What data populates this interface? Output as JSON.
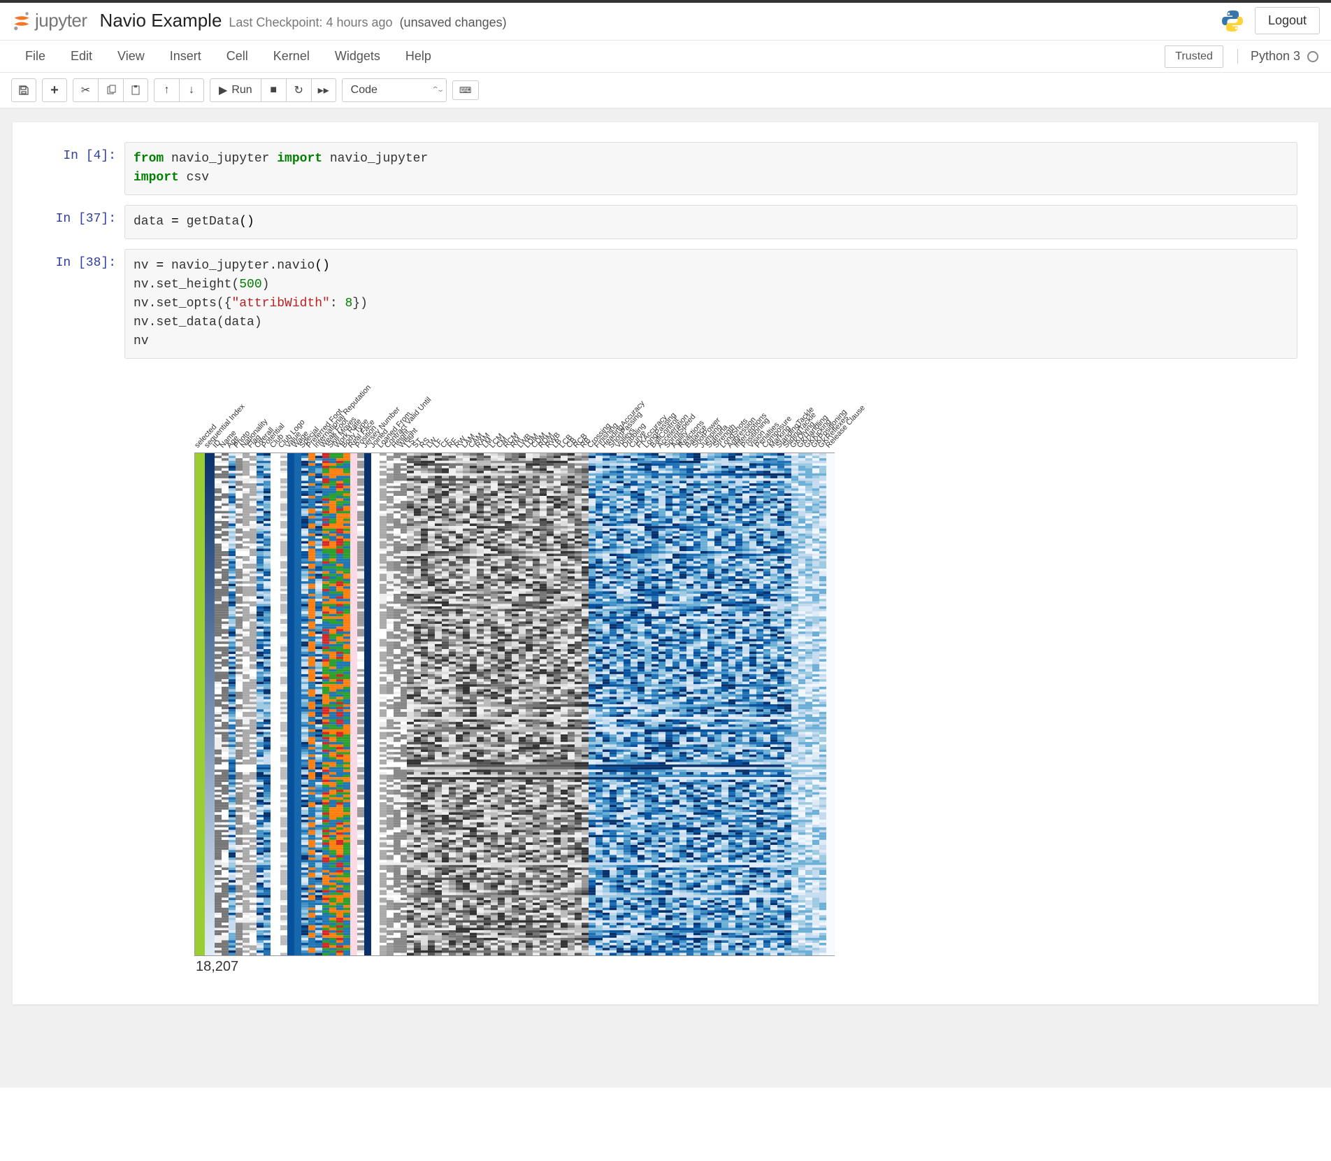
{
  "header": {
    "logo_text": "jupyter",
    "notebook_name": "Navio Example",
    "checkpoint": "Last Checkpoint: 4 hours ago",
    "unsaved": "(unsaved changes)",
    "logout": "Logout"
  },
  "menu": {
    "items": [
      "File",
      "Edit",
      "View",
      "Insert",
      "Cell",
      "Kernel",
      "Widgets",
      "Help"
    ],
    "trusted": "Trusted",
    "kernel": "Python 3"
  },
  "toolbar": {
    "run_label": "Run",
    "celltype": "Code"
  },
  "cells": [
    {
      "prompt": "In [4]:",
      "code_html": "<span class=\"kw\">from</span> navio_jupyter <span class=\"kw\">import</span> navio_jupyter\n<span class=\"kw\">import</span> csv"
    },
    {
      "prompt": "In [37]:",
      "code_html": "data <span class=\"pn\">=</span> getData<span class=\"pn\">()</span>"
    },
    {
      "prompt": "In [38]:",
      "code_html": "nv <span class=\"pn\">=</span> navio_jupyter.navio<span class=\"pn\">()</span>\nnv.set_height(<span class=\"num2\">500</span>)\nnv.set_opts({<span class=\"str\">\"attribWidth\"</span>: <span class=\"num2\">8</span>})\nnv.set_data(data)\nnv"
    }
  ],
  "navio": {
    "row_count": "18,207",
    "columns": [
      {
        "name": "selected",
        "w": 14,
        "style": "solid",
        "color": "#9ACD32"
      },
      {
        "name": "sequential Index",
        "w": 14,
        "style": "grad",
        "from": "#08306b",
        "to": "#deebf7"
      },
      {
        "name": "ID",
        "w": 10,
        "style": "bars",
        "color": "#777"
      },
      {
        "name": "Name",
        "w": 10,
        "style": "bars",
        "color": "#777"
      },
      {
        "name": "Age",
        "w": 10,
        "style": "blue"
      },
      {
        "name": "Photo",
        "w": 10,
        "style": "bars",
        "color": "#888"
      },
      {
        "name": "Nationality",
        "w": 10,
        "style": "bars",
        "color": "#aaa"
      },
      {
        "name": "Flag",
        "w": 10,
        "style": "bars",
        "color": "#aaa"
      },
      {
        "name": "Overall",
        "w": 10,
        "style": "blue"
      },
      {
        "name": "Potential",
        "w": 10,
        "style": "blue"
      },
      {
        "name": "Club",
        "w": 14,
        "style": "solid",
        "color": "#fff"
      },
      {
        "name": "Club Logo",
        "w": 10,
        "style": "bars",
        "color": "#bbb"
      },
      {
        "name": "Value",
        "w": 10,
        "style": "solid",
        "color": "#08519c"
      },
      {
        "name": "Wage",
        "w": 10,
        "style": "solid",
        "color": "#1767ad"
      },
      {
        "name": "Special",
        "w": 10,
        "style": "blue"
      },
      {
        "name": "Preferred Foot",
        "w": 10,
        "style": "cat",
        "colors": [
          "#ff7f0e",
          "#1f77b4"
        ]
      },
      {
        "name": "International Reputation",
        "w": 10,
        "style": "blue"
      },
      {
        "name": "Weak Foot",
        "w": 10,
        "style": "cat",
        "colors": [
          "#ff7f0e",
          "#2ca02c",
          "#1f77b4",
          "#d62728"
        ]
      },
      {
        "name": "Skill Moves",
        "w": 10,
        "style": "cat",
        "colors": [
          "#ff7f0e",
          "#2ca02c",
          "#1f77b4"
        ]
      },
      {
        "name": "Work Rate",
        "w": 10,
        "style": "cat",
        "colors": [
          "#ff7f0e",
          "#2ca02c",
          "#d62728",
          "#1f77b4"
        ]
      },
      {
        "name": "Body Type",
        "w": 10,
        "style": "cat",
        "colors": [
          "#ff7f0e",
          "#1f77b4",
          "#2ca02c"
        ]
      },
      {
        "name": "Real Face",
        "w": 10,
        "style": "solid",
        "color": "#fdd9e5"
      },
      {
        "name": "Position",
        "w": 10,
        "style": "bars",
        "color": "#999"
      },
      {
        "name": "Jersey Number",
        "w": 10,
        "style": "solid",
        "color": "#08306b"
      },
      {
        "name": "Joined",
        "w": 12,
        "style": "solid",
        "color": "#fff"
      },
      {
        "name": "Loaned From",
        "w": 10,
        "style": "bars",
        "color": "#aaa"
      },
      {
        "name": "Contract Valid Until",
        "w": 10,
        "style": "bars",
        "color": "#999"
      },
      {
        "name": "Height",
        "w": 10,
        "style": "bars",
        "color": "#888"
      },
      {
        "name": "Weight",
        "w": 10,
        "style": "bars",
        "color": "#888"
      },
      {
        "name": "LS",
        "w": 10,
        "style": "gray"
      },
      {
        "name": "ST",
        "w": 10,
        "style": "gray"
      },
      {
        "name": "RS",
        "w": 10,
        "style": "gray"
      },
      {
        "name": "LW",
        "w": 10,
        "style": "gray"
      },
      {
        "name": "LF",
        "w": 10,
        "style": "gray"
      },
      {
        "name": "CF",
        "w": 10,
        "style": "gray"
      },
      {
        "name": "RF",
        "w": 10,
        "style": "gray"
      },
      {
        "name": "RW",
        "w": 10,
        "style": "gray"
      },
      {
        "name": "LAM",
        "w": 10,
        "style": "gray"
      },
      {
        "name": "CAM",
        "w": 10,
        "style": "gray"
      },
      {
        "name": "RAM",
        "w": 10,
        "style": "gray"
      },
      {
        "name": "LM",
        "w": 10,
        "style": "gray"
      },
      {
        "name": "LCM",
        "w": 10,
        "style": "gray"
      },
      {
        "name": "CM",
        "w": 10,
        "style": "gray"
      },
      {
        "name": "RCM",
        "w": 10,
        "style": "gray"
      },
      {
        "name": "RM",
        "w": 10,
        "style": "gray"
      },
      {
        "name": "LWB",
        "w": 10,
        "style": "gray"
      },
      {
        "name": "LDM",
        "w": 10,
        "style": "gray"
      },
      {
        "name": "CDM",
        "w": 10,
        "style": "gray"
      },
      {
        "name": "RDM",
        "w": 10,
        "style": "gray"
      },
      {
        "name": "RWB",
        "w": 10,
        "style": "gray"
      },
      {
        "name": "LB",
        "w": 10,
        "style": "gray"
      },
      {
        "name": "LCB",
        "w": 10,
        "style": "gray"
      },
      {
        "name": "CB",
        "w": 10,
        "style": "gray"
      },
      {
        "name": "RCB",
        "w": 10,
        "style": "gray"
      },
      {
        "name": "RB",
        "w": 10,
        "style": "gray"
      },
      {
        "name": "Crossing",
        "w": 10,
        "style": "blue"
      },
      {
        "name": "Finishing",
        "w": 10,
        "style": "blue"
      },
      {
        "name": "HeadingAccuracy",
        "w": 10,
        "style": "blue"
      },
      {
        "name": "ShortPassing",
        "w": 10,
        "style": "blue"
      },
      {
        "name": "Volleys",
        "w": 10,
        "style": "blue"
      },
      {
        "name": "Dribbling",
        "w": 10,
        "style": "blue"
      },
      {
        "name": "Curve",
        "w": 10,
        "style": "blue"
      },
      {
        "name": "FKAccuracy",
        "w": 10,
        "style": "blue"
      },
      {
        "name": "LongPassing",
        "w": 10,
        "style": "blue"
      },
      {
        "name": "BallControl",
        "w": 10,
        "style": "blue"
      },
      {
        "name": "Acceleration",
        "w": 10,
        "style": "blue"
      },
      {
        "name": "SprintSpeed",
        "w": 10,
        "style": "blue"
      },
      {
        "name": "Agility",
        "w": 10,
        "style": "blue"
      },
      {
        "name": "Reactions",
        "w": 10,
        "style": "blue"
      },
      {
        "name": "Balance",
        "w": 10,
        "style": "blue"
      },
      {
        "name": "ShotPower",
        "w": 10,
        "style": "blue"
      },
      {
        "name": "Jumping",
        "w": 10,
        "style": "blue"
      },
      {
        "name": "Stamina",
        "w": 10,
        "style": "blue"
      },
      {
        "name": "Strength",
        "w": 10,
        "style": "blue"
      },
      {
        "name": "LongShots",
        "w": 10,
        "style": "blue"
      },
      {
        "name": "Aggression",
        "w": 10,
        "style": "blue"
      },
      {
        "name": "Interceptions",
        "w": 10,
        "style": "blue"
      },
      {
        "name": "Positioning",
        "w": 10,
        "style": "blue"
      },
      {
        "name": "Vision",
        "w": 10,
        "style": "blue"
      },
      {
        "name": "Penalties",
        "w": 10,
        "style": "blue"
      },
      {
        "name": "Composure",
        "w": 10,
        "style": "blue"
      },
      {
        "name": "Marking",
        "w": 10,
        "style": "blue"
      },
      {
        "name": "StandingTackle",
        "w": 10,
        "style": "blue"
      },
      {
        "name": "SlidingTackle",
        "w": 10,
        "style": "blue"
      },
      {
        "name": "GKDiving",
        "w": 10,
        "style": "lightblue"
      },
      {
        "name": "GKHandling",
        "w": 10,
        "style": "lightblue"
      },
      {
        "name": "GKKicking",
        "w": 10,
        "style": "lightblue"
      },
      {
        "name": "GKPositioning",
        "w": 10,
        "style": "lightblue"
      },
      {
        "name": "GKReflexes",
        "w": 10,
        "style": "lightblue"
      },
      {
        "name": "Release Clause",
        "w": 12,
        "style": "solid",
        "color": "#f7fbff"
      }
    ]
  }
}
